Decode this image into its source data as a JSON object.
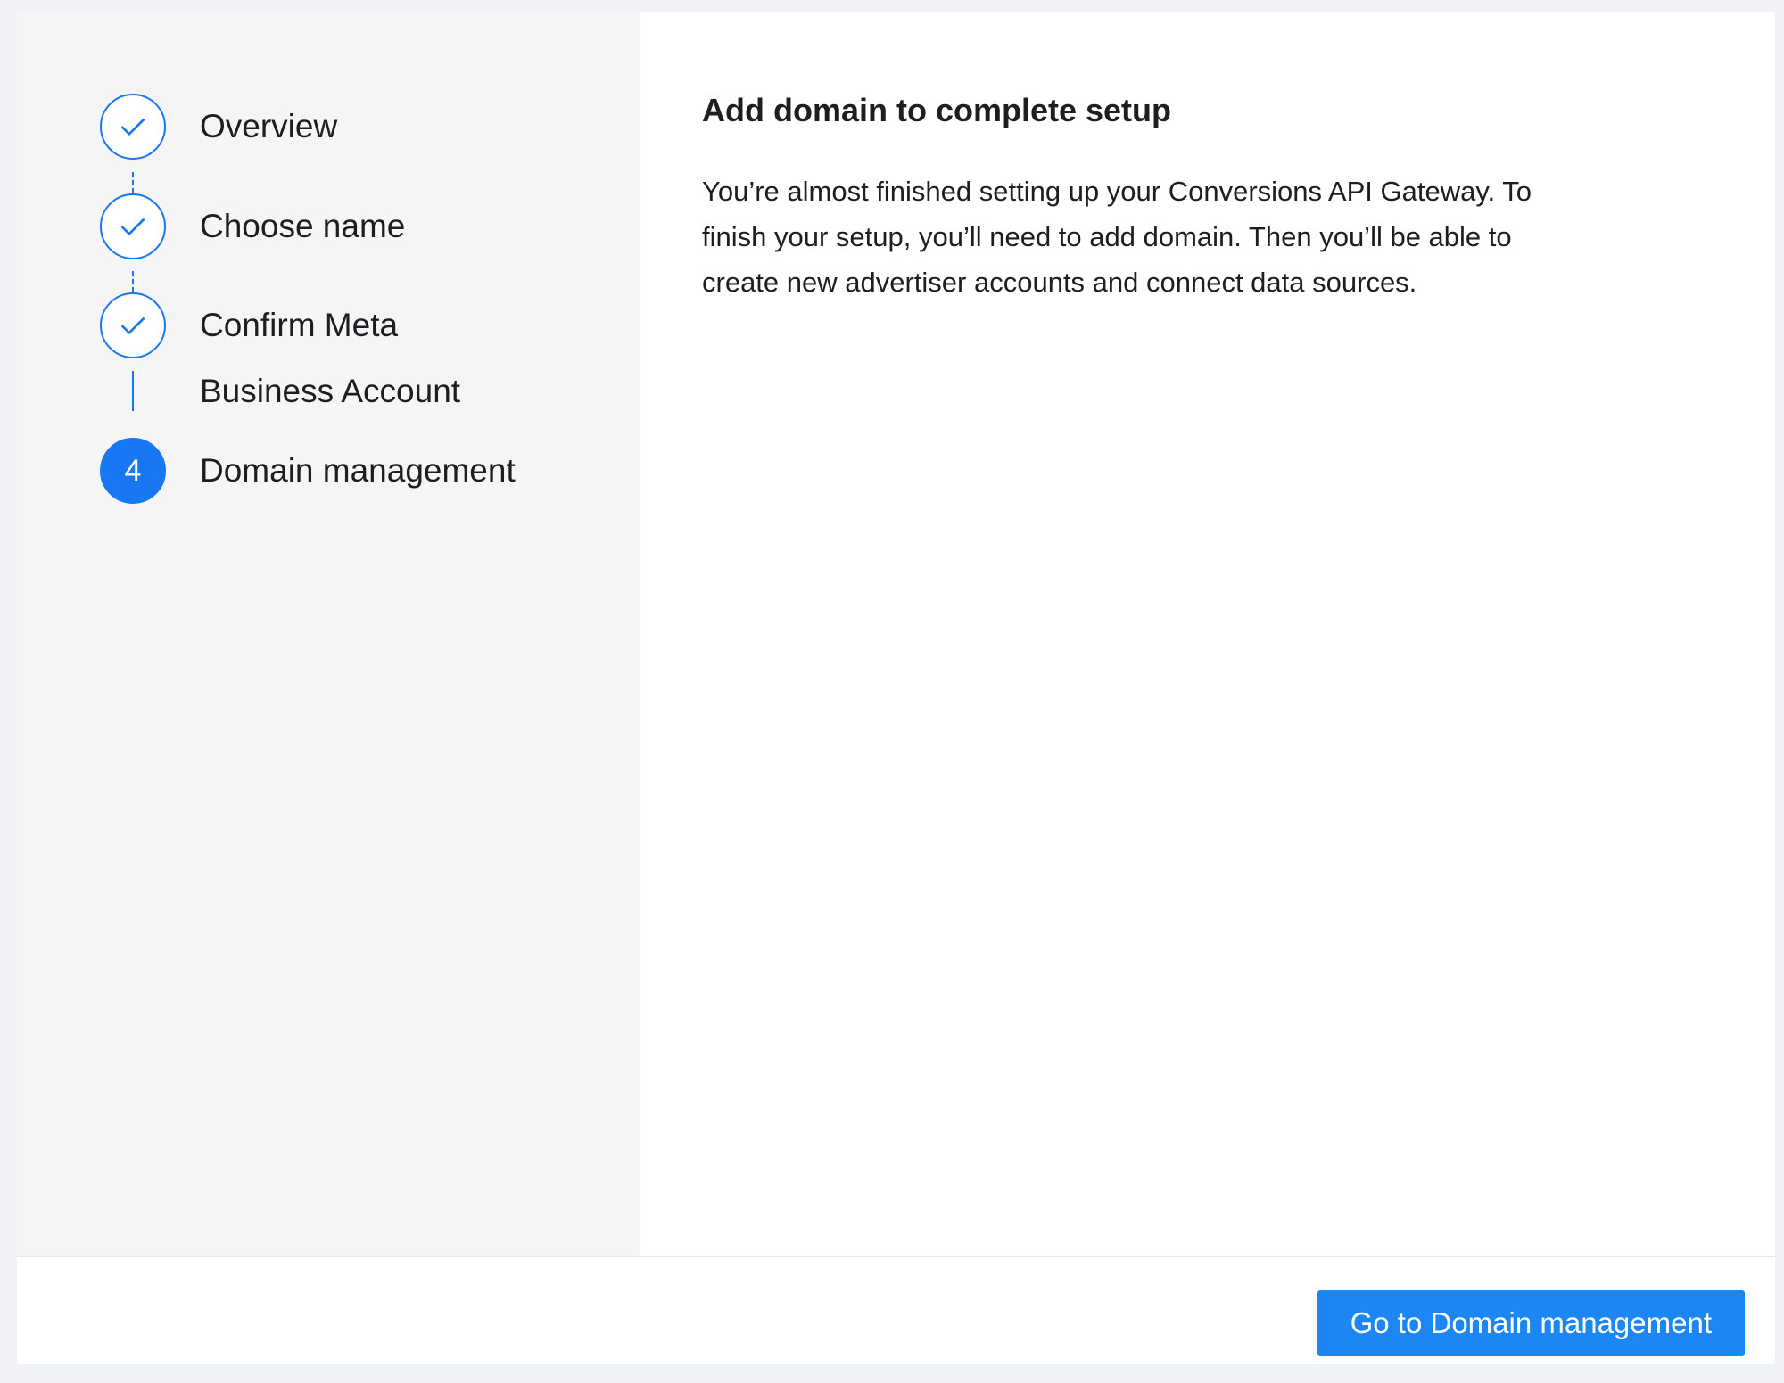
{
  "steps": [
    {
      "label": "Overview",
      "status": "complete",
      "icon": "checkmark-icon"
    },
    {
      "label": "Choose name",
      "status": "complete",
      "icon": "checkmark-icon"
    },
    {
      "label_line1": "Confirm Meta",
      "label_line2": "Business Account",
      "status": "complete",
      "icon": "checkmark-icon"
    },
    {
      "label": "Domain management",
      "status": "active",
      "number": "4"
    }
  ],
  "main": {
    "title": "Add domain to complete setup",
    "description_line1": "You’re almost finished setting up your Conversions API Gateway. To",
    "description_line2": "finish your setup, you’ll need to add domain. Then you’ll be able to",
    "description_line3": "create new advertiser accounts and connect data sources."
  },
  "footer": {
    "primary_button_label": "Go to Domain management"
  },
  "colors": {
    "accent": "#1877f2",
    "button": "#1b86f4",
    "sidebar_bg": "#f5f5f5",
    "page_bg": "#f0f2f5"
  }
}
